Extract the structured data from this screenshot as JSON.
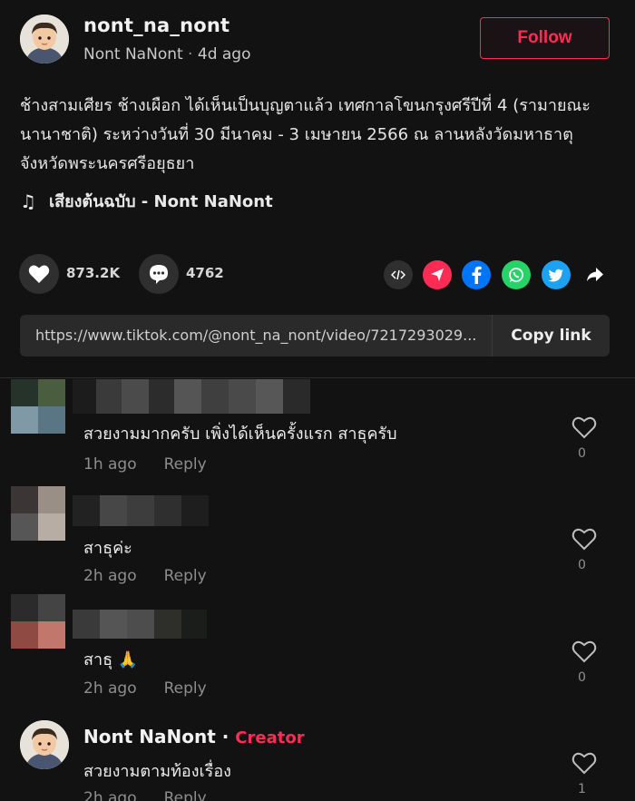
{
  "post": {
    "username": "nont_na_nont",
    "display_name": "Nont NaNont",
    "time_ago": "4d ago",
    "follow_label": "Follow",
    "caption": "ช้างสามเศียร ช้างเผือก ได้เห็นเป็นบุญตาแล้ว เทศกาลโขนกรุงศรีปีที่ 4 (รามายณะนานาชาติ) ระหว่างวันที่ 30 มีนาคม - 3 เมษายน 2566 ณ ลานหลังวัดมหาธาตุ จังหวัดพระนครศรีอยุธยา",
    "music_icon": "♫",
    "music": "เสียงต้นฉบับ - Nont NaNont",
    "likes": "873.2K",
    "comments": "4762",
    "link": "https://www.tiktok.com/@nont_na_nont/video/7217293029...",
    "copy_link_label": "Copy link",
    "share_icons": [
      "embed-icon",
      "send-icon",
      "facebook-icon",
      "whatsapp-icon",
      "twitter-icon",
      "share-arrow-icon"
    ],
    "colors": {
      "accent": "#fe2c55",
      "facebook": "#0075fa",
      "whatsapp": "#25d366",
      "twitter": "#1da1f2"
    }
  },
  "comments": [
    {
      "text": "สวยงามมากครับ เพิ่งได้เห็นครั้งแรก สาธุครับ",
      "time": "1h ago",
      "reply": "Reply",
      "likes": "0"
    },
    {
      "text": "สาธุค่ะ",
      "time": "2h ago",
      "reply": "Reply",
      "likes": "0"
    },
    {
      "text": "สาธุ 🙏",
      "time": "2h ago",
      "reply": "Reply",
      "likes": "0"
    },
    {
      "name": "Nont NaNont",
      "separator": " · ",
      "tag": "Creator",
      "text": "สวยงามตามท้องเรื่อง",
      "time": "2h ago",
      "reply": "Reply",
      "likes": "1"
    }
  ]
}
